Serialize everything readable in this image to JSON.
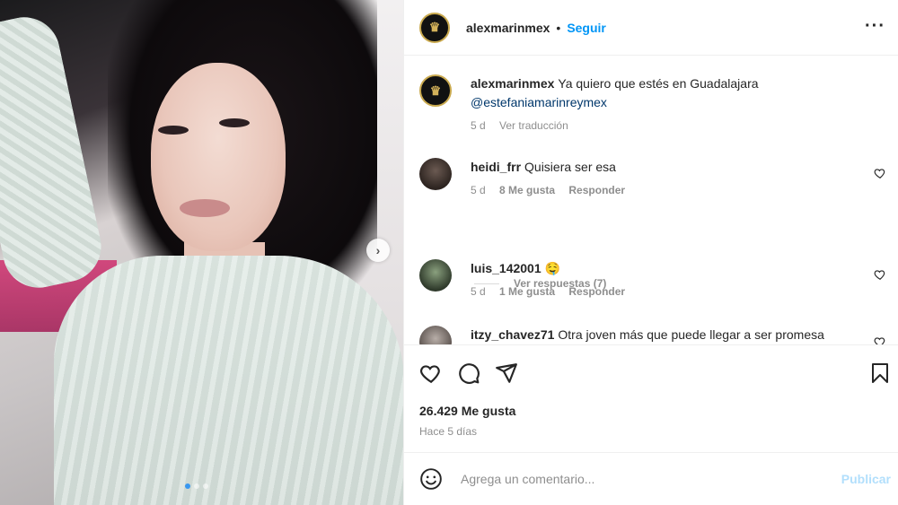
{
  "header": {
    "username": "alexmarinmex",
    "separator": "•",
    "follow_label": "Seguir",
    "more_icon": "more-horizontal-icon"
  },
  "caption": {
    "username": "alexmarinmex",
    "text": "Ya quiero que estés en Guadalajara",
    "mention": "@estefaniamarinreymex",
    "time": "5 d",
    "translate_label": "Ver traducción"
  },
  "comments": [
    {
      "username": "heidi_frr",
      "text": "Quisiera ser esa",
      "time": "5 d",
      "likes": "8 Me gusta",
      "reply_label": "Responder"
    },
    {
      "username": "luis_142001",
      "text": "🤤",
      "time": "5 d",
      "likes": "1 Me gusta",
      "reply_label": "Responder"
    },
    {
      "username": "itzy_chavez71",
      "text": "Otra joven más que puede llegar a ser promesa"
    }
  ],
  "view_replies_label": "Ver respuestas (7)",
  "actions": {
    "likes_count": "26.429 Me gusta",
    "posted_ago": "Hace 5 días"
  },
  "add_comment": {
    "placeholder": "Agrega un comentario...",
    "post_label": "Publicar"
  },
  "colors": {
    "accent": "#0095f6",
    "post_disabled": "#b2dffc",
    "meta": "#8e8e8e",
    "text": "#262626"
  }
}
